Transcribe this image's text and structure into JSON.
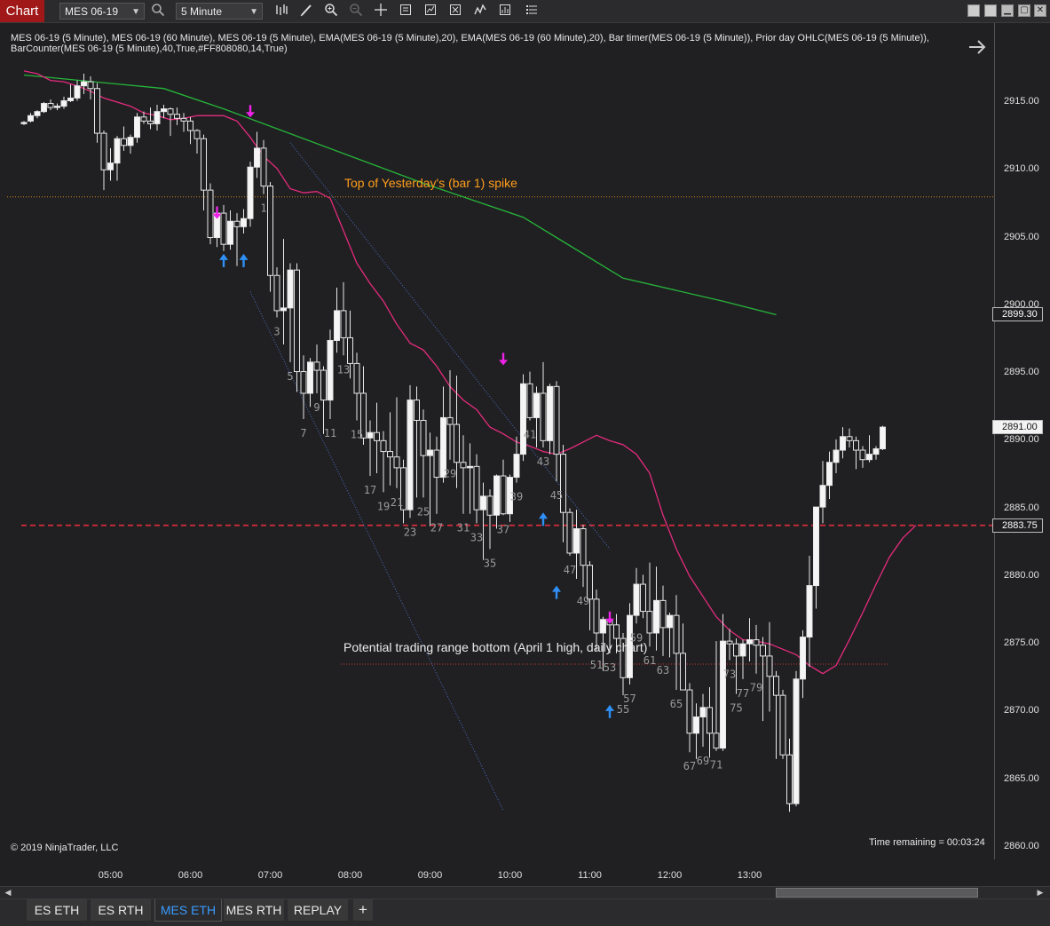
{
  "toolbar": {
    "chart_label": "Chart",
    "instrument": "MES 06-19",
    "interval": "5 Minute"
  },
  "info_line": "MES 06-19 (5 Minute), MES 06-19 (60 Minute), MES 06-19 (5 Minute), EMA(MES 06-19 (5 Minute),20), EMA(MES 06-19 (60 Minute),20), Bar timer(MES 06-19 (5 Minute)), Prior day OHLC(MES 06-19 (5 Minute)), BarCounter(MES 06-19 (5 Minute),40,True,#FF808080,14,True)",
  "copyright": "© 2019 NinjaTrader, LLC",
  "time_remaining": "Time remaining = 00:03:24",
  "annotations": {
    "top_spike": "Top of Yesterday's (bar 1) spike",
    "range_bottom": "Potential trading range bottom (April 1 high, daily chart)"
  },
  "price_tags": {
    "ema60": "2899.30",
    "last": "2891.00",
    "red_line": "2883.75"
  },
  "tabs": [
    "ES ETH",
    "ES RTH",
    "MES ETH",
    "MES RTH",
    "REPLAY"
  ],
  "active_tab": "MES ETH",
  "chart_data": {
    "type": "candlestick",
    "ylim": [
      2859.5,
      2920.5
    ],
    "y_ticks": [
      "2915.00",
      "2910.00",
      "2905.00",
      "2900.00",
      "2895.00",
      "2890.00",
      "2885.00",
      "2880.00",
      "2875.00",
      "2870.00",
      "2865.00",
      "2860.00"
    ],
    "x_ticks": [
      "05:00",
      "06:00",
      "07:00",
      "08:00",
      "09:00",
      "10:00",
      "11:00",
      "12:00",
      "13:00"
    ],
    "levels": {
      "yesterday_spike_top": 2908.0,
      "red_dashed": 2883.75,
      "april1_high": 2873.5
    },
    "bars": [
      [
        2913.5,
        2913.6,
        2913.3,
        2913.5
      ],
      [
        2913.6,
        2914.2,
        2913.5,
        2914.0
      ],
      [
        2914.0,
        2914.4,
        2913.8,
        2914.3
      ],
      [
        2914.3,
        2915.0,
        2914.2,
        2914.9
      ],
      [
        2914.9,
        2915.2,
        2914.4,
        2914.6
      ],
      [
        2914.6,
        2914.9,
        2914.4,
        2914.7
      ],
      [
        2914.7,
        2915.4,
        2914.5,
        2915.1
      ],
      [
        2915.1,
        2916.3,
        2915.0,
        2915.3
      ],
      [
        2915.3,
        2916.6,
        2915.1,
        2916.2
      ],
      [
        2916.2,
        2917.1,
        2915.6,
        2916.5
      ],
      [
        2916.5,
        2916.9,
        2915.2,
        2916.0
      ],
      [
        2916.0,
        2916.4,
        2912.0,
        2912.7
      ],
      [
        2912.7,
        2912.9,
        2908.5,
        2910.0
      ],
      [
        2910.0,
        2911.6,
        2909.2,
        2910.5
      ],
      [
        2910.5,
        2912.5,
        2909.2,
        2912.3
      ],
      [
        2912.3,
        2913.2,
        2911.4,
        2911.8
      ],
      [
        2911.8,
        2912.6,
        2911.2,
        2912.4
      ],
      [
        2912.4,
        2914.2,
        2912.0,
        2913.9
      ],
      [
        2913.9,
        2914.3,
        2913.4,
        2913.6
      ],
      [
        2913.6,
        2914.6,
        2913.0,
        2913.4
      ],
      [
        2913.4,
        2914.8,
        2912.9,
        2914.3
      ],
      [
        2914.3,
        2914.8,
        2913.8,
        2914.5
      ],
      [
        2914.5,
        2914.6,
        2912.5,
        2914.1
      ],
      [
        2914.1,
        2914.6,
        2913.3,
        2913.8
      ],
      [
        2913.8,
        2914.2,
        2912.8,
        2913.6
      ],
      [
        2913.6,
        2913.9,
        2911.9,
        2912.9
      ],
      [
        2912.9,
        2913.0,
        2911.2,
        2912.3
      ],
      [
        2912.3,
        2912.6,
        2907.0,
        2908.5
      ],
      [
        2908.5,
        2909.0,
        2904.5,
        2905.0
      ],
      [
        2905.0,
        2907.3,
        2904.3,
        2906.8
      ],
      [
        2906.8,
        2907.4,
        2904.0,
        2904.5
      ],
      [
        2904.5,
        2907.0,
        2904.1,
        2906.2
      ],
      [
        2906.2,
        2906.8,
        2902.9,
        2905.8
      ],
      [
        2905.8,
        2907.1,
        2905.3,
        2906.4
      ],
      [
        2906.4,
        2910.6,
        2905.8,
        2910.2
      ],
      [
        2910.2,
        2912.8,
        2909.4,
        2911.6
      ],
      [
        2911.6,
        2912.2,
        2908.2,
        2908.8
      ],
      [
        2908.8,
        2909.1,
        2901.0,
        2902.2
      ],
      [
        2902.2,
        2902.8,
        2899.1,
        2899.6
      ],
      [
        2899.6,
        2904.9,
        2897.1,
        2899.8
      ],
      [
        2899.8,
        2903.1,
        2895.8,
        2902.6
      ],
      [
        2902.6,
        2903.1,
        2893.6,
        2895.1
      ],
      [
        2895.1,
        2896.3,
        2891.6,
        2893.5
      ],
      [
        2893.5,
        2896.1,
        2892.5,
        2895.8
      ],
      [
        2895.8,
        2897.1,
        2893.5,
        2895.2
      ],
      [
        2895.2,
        2895.5,
        2890.5,
        2893.0
      ],
      [
        2893.0,
        2898.2,
        2891.6,
        2897.4
      ],
      [
        2897.4,
        2901.3,
        2896.5,
        2899.6
      ],
      [
        2899.6,
        2901.7,
        2896.3,
        2897.6
      ],
      [
        2897.6,
        2899.6,
        2894.6,
        2895.7
      ],
      [
        2895.7,
        2896.5,
        2891.5,
        2893.5
      ],
      [
        2893.5,
        2895.5,
        2889.7,
        2890.2
      ],
      [
        2890.2,
        2891.5,
        2887.4,
        2890.6
      ],
      [
        2890.6,
        2892.8,
        2887.6,
        2890.0
      ],
      [
        2890.0,
        2890.7,
        2886.2,
        2889.2
      ],
      [
        2889.2,
        2892.1,
        2886.7,
        2888.8
      ],
      [
        2888.8,
        2893.2,
        2886.5,
        2888.0
      ],
      [
        2888.0,
        2888.6,
        2883.9,
        2884.9
      ],
      [
        2884.9,
        2894.1,
        2884.3,
        2893.0
      ],
      [
        2893.0,
        2894.0,
        2885.8,
        2891.5
      ],
      [
        2891.5,
        2892.3,
        2885.8,
        2888.9
      ],
      [
        2888.9,
        2890.6,
        2883.7,
        2889.3
      ],
      [
        2889.3,
        2890.3,
        2884.6,
        2887.3
      ],
      [
        2887.3,
        2894.0,
        2886.9,
        2891.7
      ],
      [
        2891.7,
        2895.2,
        2888.6,
        2891.2
      ],
      [
        2891.2,
        2894.8,
        2886.5,
        2888.4
      ],
      [
        2888.4,
        2890.4,
        2884.6,
        2888.0
      ],
      [
        2888.0,
        2889.8,
        2884.6,
        2888.1
      ],
      [
        2888.1,
        2889.0,
        2883.9,
        2884.9
      ],
      [
        2884.9,
        2886.9,
        2881.2,
        2885.9
      ],
      [
        2885.9,
        2886.4,
        2882.0,
        2884.5
      ],
      [
        2884.5,
        2887.5,
        2883.5,
        2887.4
      ],
      [
        2887.4,
        2888.6,
        2884.5,
        2884.6
      ],
      [
        2884.6,
        2887.5,
        2884.0,
        2887.3
      ],
      [
        2887.3,
        2890.3,
        2886.9,
        2889.0
      ],
      [
        2889.0,
        2894.9,
        2888.5,
        2894.2
      ],
      [
        2894.2,
        2895.1,
        2891.5,
        2891.7
      ],
      [
        2891.7,
        2894.0,
        2889.5,
        2893.5
      ],
      [
        2893.5,
        2895.8,
        2889.5,
        2890.0
      ],
      [
        2890.0,
        2894.2,
        2889.0,
        2894.0
      ],
      [
        2894.0,
        2894.4,
        2887.0,
        2889.0
      ],
      [
        2889.0,
        2889.7,
        2882.5,
        2884.7
      ],
      [
        2884.7,
        2885.0,
        2881.5,
        2881.7
      ],
      [
        2881.7,
        2884.9,
        2879.8,
        2883.5
      ],
      [
        2883.5,
        2883.8,
        2879.2,
        2880.8
      ],
      [
        2880.8,
        2881.1,
        2876.0,
        2878.3
      ],
      [
        2878.3,
        2879.0,
        2874.5,
        2875.8
      ],
      [
        2875.8,
        2877.0,
        2873.0,
        2876.8
      ],
      [
        2876.8,
        2877.3,
        2874.3,
        2876.4
      ],
      [
        2876.4,
        2877.2,
        2874.3,
        2875.4
      ],
      [
        2875.4,
        2875.8,
        2871.2,
        2872.5
      ],
      [
        2872.5,
        2878.0,
        2872.0,
        2877.1
      ],
      [
        2877.1,
        2880.6,
        2876.5,
        2879.4
      ],
      [
        2879.4,
        2880.1,
        2876.9,
        2877.4
      ],
      [
        2877.4,
        2881.0,
        2874.8,
        2875.8
      ],
      [
        2875.8,
        2880.7,
        2874.5,
        2878.2
      ],
      [
        2878.2,
        2879.3,
        2874.1,
        2876.2
      ],
      [
        2876.2,
        2877.3,
        2874.0,
        2877.1
      ],
      [
        2877.1,
        2878.6,
        2871.6,
        2874.3
      ],
      [
        2874.3,
        2876.5,
        2872.3,
        2871.6
      ],
      [
        2871.6,
        2872.1,
        2867.0,
        2868.4
      ],
      [
        2868.4,
        2870.6,
        2866.5,
        2869.6
      ],
      [
        2869.6,
        2871.3,
        2867.4,
        2870.3
      ],
      [
        2870.3,
        2871.8,
        2866.6,
        2868.4
      ],
      [
        2868.4,
        2875.2,
        2867.1,
        2867.3
      ],
      [
        2867.3,
        2877.2,
        2867.1,
        2875.2
      ],
      [
        2875.2,
        2876.1,
        2873.8,
        2875.0
      ],
      [
        2875.0,
        2875.4,
        2871.3,
        2874.1
      ],
      [
        2874.1,
        2875.3,
        2872.4,
        2875.0
      ],
      [
        2875.0,
        2876.9,
        2873.7,
        2875.3
      ],
      [
        2875.3,
        2876.4,
        2872.8,
        2874.9
      ],
      [
        2874.9,
        2875.5,
        2869.3,
        2874.1
      ],
      [
        2874.1,
        2876.6,
        2870.0,
        2872.6
      ],
      [
        2872.6,
        2873.0,
        2866.5,
        2871.2
      ],
      [
        2871.2,
        2871.6,
        2866.5,
        2866.8
      ],
      [
        2866.8,
        2868.0,
        2862.6,
        2863.2
      ],
      [
        2863.2,
        2873.0,
        2863.0,
        2872.4
      ],
      [
        2872.4,
        2876.0,
        2871.0,
        2875.5
      ],
      [
        2875.5,
        2881.5,
        2873.3,
        2879.3
      ],
      [
        2879.3,
        2884.7,
        2877.6,
        2885.1
      ],
      [
        2885.1,
        2888.5,
        2883.9,
        2886.7
      ],
      [
        2886.7,
        2889.2,
        2885.7,
        2888.4
      ],
      [
        2888.4,
        2890.1,
        2887.6,
        2889.3
      ],
      [
        2889.3,
        2891.0,
        2888.7,
        2890.3
      ],
      [
        2890.3,
        2890.9,
        2889.5,
        2890.0
      ],
      [
        2890.0,
        2890.3,
        2887.9,
        2889.3
      ],
      [
        2889.3,
        2889.6,
        2888.0,
        2888.6
      ],
      [
        2888.6,
        2890.4,
        2888.4,
        2889.0
      ],
      [
        2889.0,
        2889.6,
        2888.6,
        2889.4
      ],
      [
        2889.4,
        2891.1,
        2889.3,
        2891.0
      ]
    ],
    "bar_labels": [
      [
        36,
        "1"
      ],
      [
        38,
        "3"
      ],
      [
        40,
        "5"
      ],
      [
        42,
        "7"
      ],
      [
        44,
        "9"
      ],
      [
        46,
        "11"
      ],
      [
        48,
        "13"
      ],
      [
        50,
        "15"
      ],
      [
        52,
        "17"
      ],
      [
        54,
        "19"
      ],
      [
        56,
        "21"
      ],
      [
        58,
        "23"
      ],
      [
        60,
        "25"
      ],
      [
        62,
        "27"
      ],
      [
        64,
        "29"
      ],
      [
        66,
        "31"
      ],
      [
        68,
        "33"
      ],
      [
        70,
        "35"
      ],
      [
        72,
        "37"
      ],
      [
        74,
        "39"
      ],
      [
        76,
        "41"
      ],
      [
        78,
        "43"
      ],
      [
        80,
        "45"
      ],
      [
        82,
        "47"
      ],
      [
        84,
        "49"
      ],
      [
        86,
        "51"
      ],
      [
        88,
        "53"
      ],
      [
        90,
        "55"
      ],
      [
        91,
        "57"
      ],
      [
        92,
        "59"
      ],
      [
        94,
        "61"
      ],
      [
        96,
        "63"
      ],
      [
        98,
        "65"
      ],
      [
        100,
        "67"
      ],
      [
        102,
        "69"
      ],
      [
        104,
        "71"
      ],
      [
        106,
        "73"
      ],
      [
        107,
        "75"
      ],
      [
        108,
        "77"
      ],
      [
        110,
        "79"
      ]
    ],
    "ema20_5min": [
      [
        2917.3,
        2917.1
      ],
      [
        2916.6,
        2916.5
      ],
      [
        2916.2,
        2915.8
      ],
      [
        2915.3,
        2915.0
      ],
      [
        2914.7,
        2914.2
      ],
      [
        2914.0,
        2913.7
      ],
      [
        2913.8,
        2914.0
      ],
      [
        2914.0,
        2914.0
      ],
      [
        2913.6,
        2912.4
      ],
      [
        2911.0,
        2910.1
      ],
      [
        2908.6,
        2908.3
      ],
      [
        2908.4,
        2907.9
      ],
      [
        2905.5,
        2903.1
      ],
      [
        2901.6,
        2900.3
      ],
      [
        2898.6,
        2897.2
      ],
      [
        2896.7,
        2895.5
      ],
      [
        2894.0,
        2893.0
      ],
      [
        2892.3,
        2891.0
      ],
      [
        2890.5,
        2889.9
      ],
      [
        2889.6,
        2889.2
      ],
      [
        2889.0,
        2889.4
      ],
      [
        2889.9,
        2890.4
      ],
      [
        2890.0,
        2889.7
      ],
      [
        2889.0,
        2887.6
      ],
      [
        2884.5,
        2882.0
      ],
      [
        2880.0,
        2878.5
      ],
      [
        2877.0,
        2876.0
      ],
      [
        2875.3,
        2875.2
      ],
      [
        2875.0,
        2874.6
      ],
      [
        2874.2,
        2873.4
      ],
      [
        2872.8,
        2873.4
      ],
      [
        2875.3,
        2877.3
      ],
      [
        2879.4,
        2881.4
      ],
      [
        2882.8,
        2883.75
      ]
    ],
    "ema20_60min": [
      [
        0,
        2917.0
      ],
      [
        21,
        2916.0
      ],
      [
        30,
        2914.5
      ],
      [
        60,
        2909.0
      ],
      [
        75,
        2906.5
      ],
      [
        90,
        2902.0
      ],
      [
        105,
        2900.3
      ],
      [
        113,
        2899.3
      ]
    ],
    "arrows_down": [
      [
        34,
        2914.0
      ],
      [
        29,
        2906.5
      ],
      [
        72,
        2895.7
      ],
      [
        88,
        2876.6
      ]
    ],
    "arrows_up": [
      [
        30,
        2903.6
      ],
      [
        33,
        2903.6
      ],
      [
        78,
        2884.5
      ],
      [
        80,
        2879.1
      ],
      [
        88,
        2870.3
      ]
    ]
  }
}
